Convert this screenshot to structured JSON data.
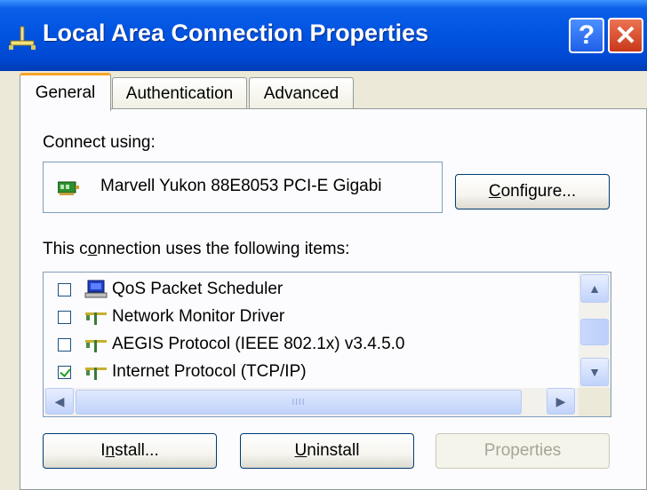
{
  "window": {
    "title": "Local Area Connection Properties",
    "help_label": "?",
    "close_label": "✕"
  },
  "tabs": [
    {
      "label": "General",
      "active": true
    },
    {
      "label": "Authentication",
      "active": false
    },
    {
      "label": "Advanced",
      "active": false
    }
  ],
  "general": {
    "connect_using_label": "Connect using:",
    "adapter_name": "Marvell Yukon 88E8053 PCI-E Gigabi",
    "configure_button": {
      "prefix": "",
      "mnemonic": "C",
      "rest": "onfigure..."
    },
    "items_label": {
      "prefix": "This c",
      "mnemonic": "o",
      "rest": "nnection uses the following items:"
    },
    "items": [
      {
        "label": "QoS Packet Scheduler",
        "checked": false,
        "icon": "network-service-icon"
      },
      {
        "label": "Network Monitor Driver",
        "checked": false,
        "icon": "network-protocol-icon"
      },
      {
        "label": "AEGIS Protocol (IEEE 802.1x) v3.4.5.0",
        "checked": false,
        "icon": "network-protocol-icon"
      },
      {
        "label": "Internet Protocol (TCP/IP)",
        "checked": true,
        "icon": "network-protocol-icon"
      }
    ],
    "scroll_grip": "IIII",
    "install_button": {
      "prefix": "I",
      "mnemonic": "n",
      "rest": "stall..."
    },
    "uninstall_button": {
      "prefix": "",
      "mnemonic": "U",
      "rest": "ninstall"
    },
    "properties_button": {
      "label": "Properties",
      "enabled": false
    }
  },
  "colors": {
    "title_bar": "#0053e0",
    "active_tab_accent": "#f7a427",
    "dialog_bg": "#ece9d8",
    "checkmark": "#21a121"
  }
}
